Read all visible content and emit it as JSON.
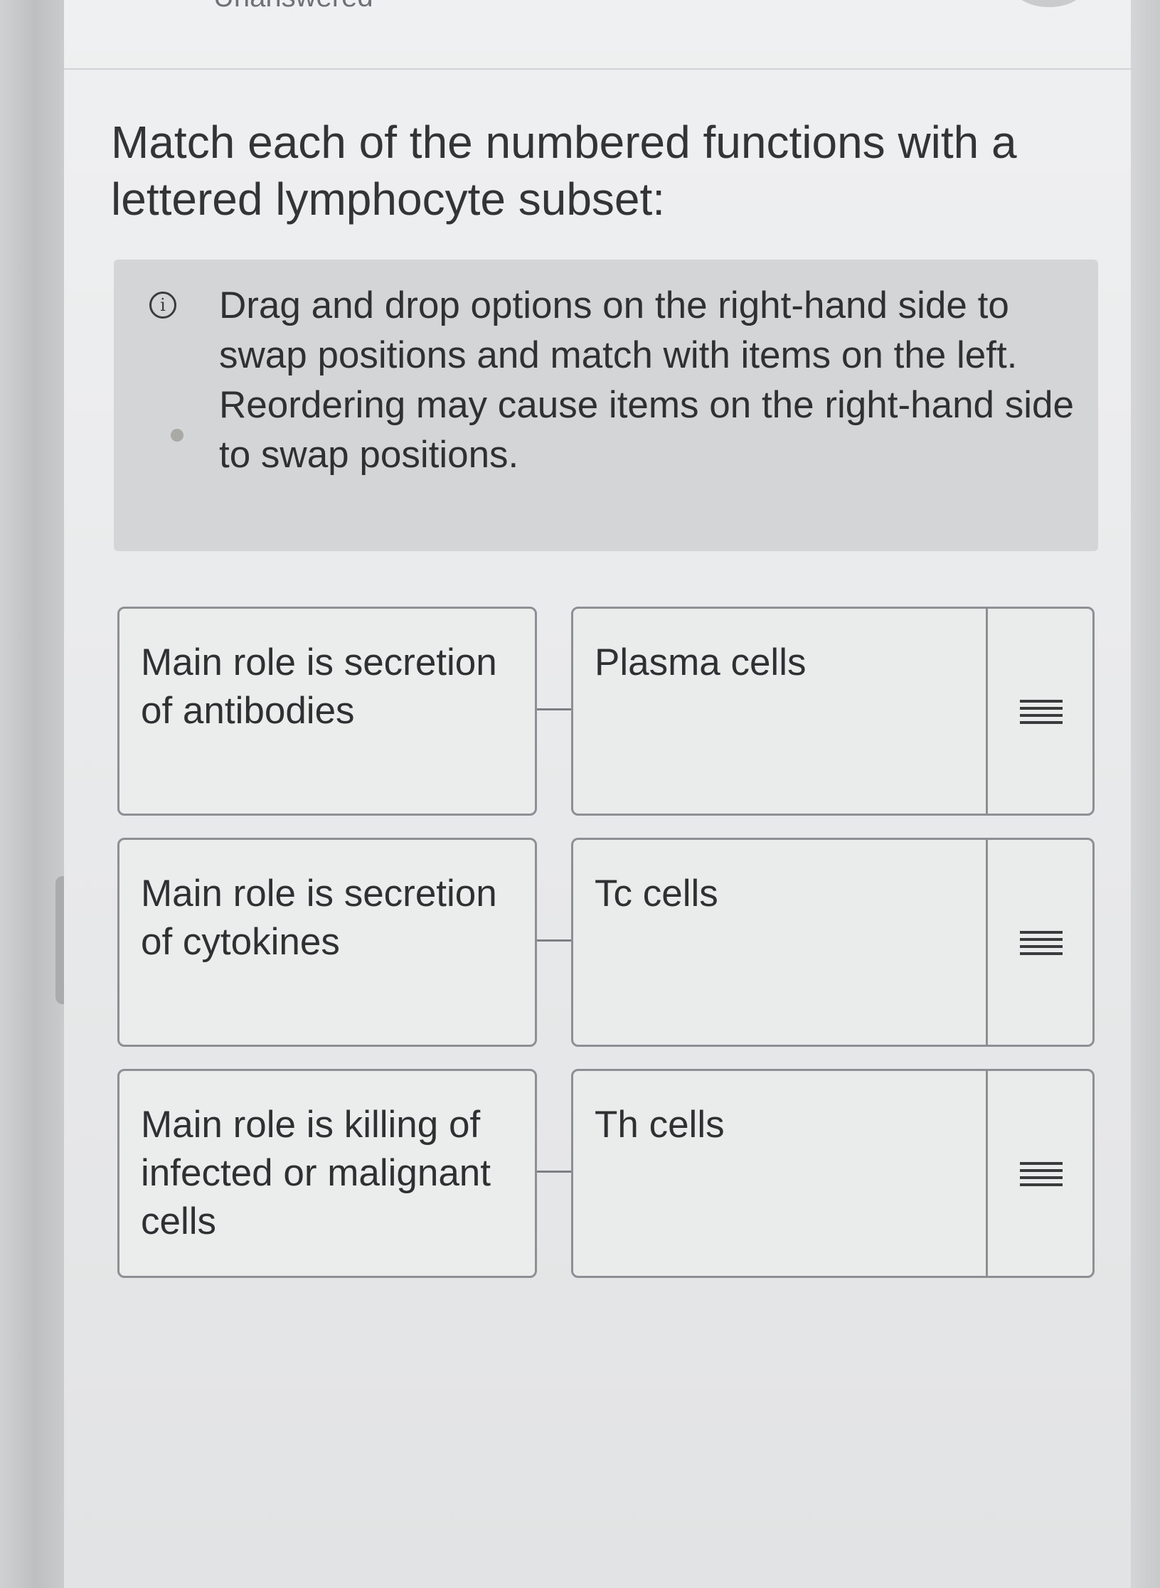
{
  "header": {
    "status": "Unanswered"
  },
  "question": {
    "prompt": "Match each of the numbered functions with a lettered lymphocyte subset:"
  },
  "instructions": {
    "icon": "info-icon",
    "line1": "Drag and drop options on the right-hand side to swap positions and match with items on the left.",
    "line2": "Reordering may cause items on the right-hand side to swap positions."
  },
  "pairs": [
    {
      "function": "Main role is secretion of antibodies",
      "option": "Plasma cells",
      "handle_icon": "drag-handle-icon"
    },
    {
      "function": "Main role is secretion of cytokines",
      "option": "Tc cells",
      "handle_icon": "drag-handle-icon"
    },
    {
      "function": "Main role is killing of infected or malignant cells",
      "option": "Th cells",
      "handle_icon": "drag-handle-icon"
    }
  ],
  "colors": {
    "card_border": "#8d8f92",
    "info_background": "#d3d5d7",
    "text": "#2f3032"
  }
}
